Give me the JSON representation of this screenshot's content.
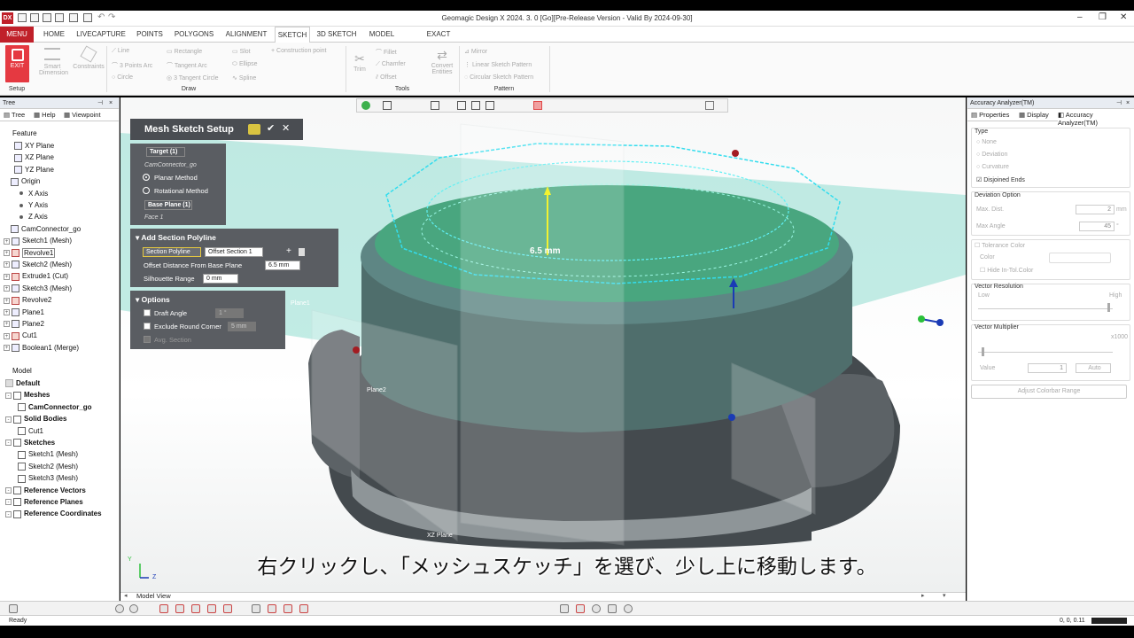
{
  "app": {
    "logo": "DX",
    "title": "Geomagic Design X 2024. 3. 0 [Go][Pre-Release Version - Valid By 2024-09-30]"
  },
  "ribbon": {
    "menu": "MENU",
    "tabs": [
      "HOME",
      "LIVECAPTURE",
      "POINTS",
      "POLYGONS",
      "ALIGNMENT",
      "SKETCH",
      "3D SKETCH",
      "MODEL",
      "EXACT SURFACING"
    ],
    "active_tab": "SKETCH",
    "exit": "EXIT",
    "smart_dimension": "Smart Dimension",
    "constraints": "Constraints",
    "draw": [
      "Line",
      "3 Points Arc",
      "Circle",
      "Rectangle",
      "Tangent Arc",
      "3 Tangent Circle",
      "Slot",
      "Ellipse",
      "Spline",
      "Construction point"
    ],
    "tools": [
      "Trim",
      "Fillet",
      "Chamfer",
      "Offset",
      "Convert Entities"
    ],
    "pattern": [
      "Mirror",
      "Linear Sketch Pattern",
      "Circular Sketch Pattern"
    ],
    "groups": [
      "Setup",
      "Draw",
      "Tools",
      "Pattern"
    ]
  },
  "tree": {
    "title": "Tree",
    "subtabs": [
      "Tree",
      "Help",
      "Viewpoint"
    ],
    "feature_header": "Feature",
    "features": [
      "XY Plane",
      "XZ Plane",
      "YZ Plane",
      "Origin",
      "X Axis",
      "Y Axis",
      "Z Axis",
      "CamConnector_go",
      "Sketch1 (Mesh)",
      "Revolve1",
      "Sketch2 (Mesh)",
      "Extrude1 (Cut)",
      "Sketch3 (Mesh)",
      "Revolve2",
      "Plane1",
      "Plane2",
      "Cut1",
      "Boolean1 (Merge)"
    ],
    "model_header": "Model",
    "model": [
      "Default",
      "Meshes",
      "CamConnector_go",
      "Solid Bodies",
      "Cut1",
      "Sketches",
      "Sketch1 (Mesh)",
      "Sketch2 (Mesh)",
      "Sketch3 (Mesh)",
      "Reference Vectors",
      "Reference Planes",
      "Reference Coordinates"
    ]
  },
  "dialog": {
    "title": "Mesh Sketch Setup",
    "target_label": "Target (1)",
    "target_value": "CamConnector_go",
    "planar": "Planar Method",
    "rotational": "Rotational Method",
    "base_plane_label": "Base Plane (1)",
    "base_plane_value": "Face 1",
    "polyline_header": "Add Section Polyline",
    "section_polyline": "Section Polyline",
    "section_value": "Offset Section 1",
    "offset_label": "Offset Distance From Base Plane",
    "offset_value": "6.5 mm",
    "silhouette_label": "Silhouette Range",
    "silhouette_value": "0 mm",
    "options_header": "Options",
    "draft_angle": "Draft Angle",
    "draft_value": "1 °",
    "exclude_round": "Exclude Round Corner",
    "exclude_value": "5 mm",
    "avg_section": "Avg. Section"
  },
  "viewport": {
    "dimension": "6.5 mm",
    "plane1": "Plane1",
    "plane2": "Plane2",
    "xzplane": "XZ Plane",
    "model_view_tab": "Model View",
    "axis_y": "Y",
    "axis_z": "Z",
    "subtitle": "右クリックし、「メッシュスケッチ」を選び、少し上に移動します。"
  },
  "analyzer": {
    "title": "Accuracy Analyzer(TM)",
    "tabs": [
      "Properties",
      "Display",
      "Accuracy Analyzer(TM)"
    ],
    "type_label": "Type",
    "types": [
      "None",
      "Deviation",
      "Curvature",
      "Disjoined Ends"
    ],
    "deviation_option": "Deviation Option",
    "max_dist": "Max. Dist.",
    "max_dist_value": "2",
    "max_dist_unit": "mm",
    "max_angle": "Max Angle",
    "max_angle_value": "45",
    "max_angle_unit": "°",
    "tolerance_color": "Tolerance Color",
    "color": "Color",
    "hide_in_tol": "Hide In-Tol.Color",
    "vector_resolution": "Vector Resolution",
    "low": "Low",
    "high": "High",
    "vector_multiplier": "Vector Multiplier",
    "x1000": "x1000",
    "value": "Value",
    "value_num": "1",
    "auto": "Auto",
    "adjust": "Adjust Colorbar Range"
  },
  "status": {
    "text": "Ready",
    "coords": "0, 0, 0.11"
  },
  "colors": {
    "brand": "#c0202a",
    "mesh": "#5a7676",
    "plane": "#7fd6c4",
    "polyline": "#33ddee"
  }
}
